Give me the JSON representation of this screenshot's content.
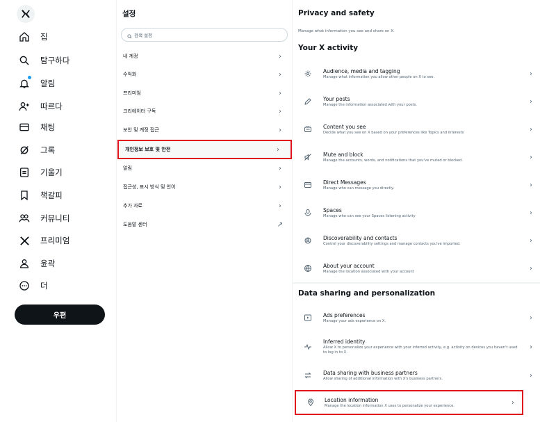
{
  "nav": {
    "items": [
      {
        "icon": "home-icon",
        "label": "집"
      },
      {
        "icon": "search-icon",
        "label": "탐구하다"
      },
      {
        "icon": "bell-icon",
        "label": "알림"
      },
      {
        "icon": "follow-icon",
        "label": "따르다"
      },
      {
        "icon": "mail-icon",
        "label": "채팅"
      },
      {
        "icon": "grok-icon",
        "label": "그록"
      },
      {
        "icon": "list-icon",
        "label": "기울기"
      },
      {
        "icon": "bookmark-icon",
        "label": "책갈피"
      },
      {
        "icon": "communities-icon",
        "label": "커뮤니티"
      },
      {
        "icon": "x-logo-icon",
        "label": "프리미엄"
      },
      {
        "icon": "profile-icon",
        "label": "윤곽"
      },
      {
        "icon": "more-icon",
        "label": "더"
      }
    ],
    "post_button": "우편"
  },
  "settings": {
    "title": "설정",
    "search_placeholder": "검색 설정",
    "items": [
      {
        "label": "내 계정",
        "arrow": "›"
      },
      {
        "label": "수익화",
        "arrow": "›"
      },
      {
        "label": "프리미엄",
        "arrow": "›"
      },
      {
        "label": "크리에이터 구독",
        "arrow": "›"
      },
      {
        "label": "보안 및 계정 접근",
        "arrow": "›"
      },
      {
        "label": "개인정보 보호 및 안전",
        "arrow": "›"
      },
      {
        "label": "알림",
        "arrow": "›"
      },
      {
        "label": "접근성, 표시 방식 및 언어",
        "arrow": "›"
      },
      {
        "label": "추가 자료",
        "arrow": "›"
      },
      {
        "label": "도움말 센터",
        "arrow": "↗"
      }
    ]
  },
  "panel": {
    "title": "Privacy and safety",
    "description": "Manage what information you see and share on X.",
    "section1_title": "Your X activity",
    "section1_items": [
      {
        "icon": "audience-icon",
        "title": "Audience, media and tagging",
        "desc": "Manage what information you allow other people on X to see."
      },
      {
        "icon": "pencil-icon",
        "title": "Your posts",
        "desc": "Manage the information associated with your posts."
      },
      {
        "icon": "content-icon",
        "title": "Content you see",
        "desc": "Decide what you see on X based on your preferences like Topics and interests"
      },
      {
        "icon": "mute-icon",
        "title": "Mute and block",
        "desc": "Manage the accounts, words, and notifications that you've muted or blocked."
      },
      {
        "icon": "mail-icon",
        "title": "Direct Messages",
        "desc": "Manage who can message you directly."
      },
      {
        "icon": "spaces-icon",
        "title": "Spaces",
        "desc": "Manage who can see your Spaces listening activity"
      },
      {
        "icon": "discover-icon",
        "title": "Discoverability and contacts",
        "desc": "Control your discoverability settings and manage contacts you've imported."
      },
      {
        "icon": "globe-icon",
        "title": "About your account",
        "desc": "Manage the location associated with your account"
      }
    ],
    "section2_title": "Data sharing and personalization",
    "section2_items": [
      {
        "icon": "ads-icon",
        "title": "Ads preferences",
        "desc": "Manage your ads experience on X."
      },
      {
        "icon": "activity-icon",
        "title": "Inferred identity",
        "desc": "Allow X to personalize your experience with your inferred activity, e.g. activity on devices you haven't used to log in to X."
      },
      {
        "icon": "share-arrows-icon",
        "title": "Data sharing with business partners",
        "desc": "Allow sharing of additional information with X's business partners."
      },
      {
        "icon": "location-pin-icon",
        "title": "Location information",
        "desc": "Manage the location information X uses to personalize your experience."
      }
    ],
    "arrow": "›"
  },
  "colors": {
    "highlight": "#e0141c",
    "accent": "#1d9bf0",
    "text": "#0f1419",
    "muted": "#536471"
  }
}
